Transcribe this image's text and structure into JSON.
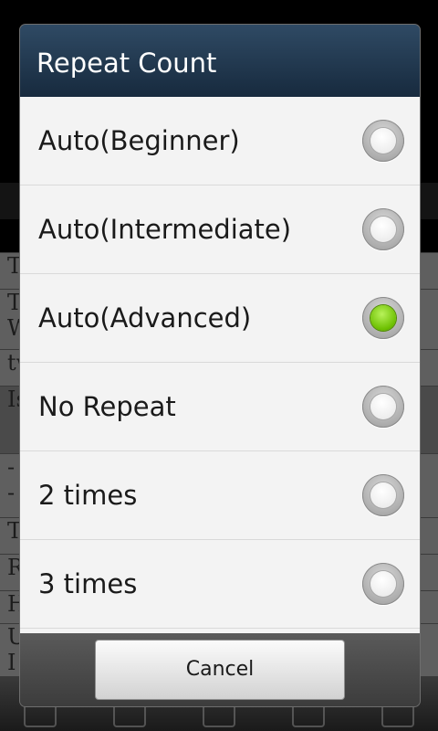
{
  "background": {
    "row_fragments": [
      "T",
      "T",
      "W",
      "tw",
      "Is",
      "-",
      "-",
      "T",
      "R",
      "H",
      "U",
      "I"
    ]
  },
  "dialog": {
    "title": "Repeat Count",
    "options": [
      {
        "label": "Auto(Beginner)",
        "checked": false
      },
      {
        "label": "Auto(Intermediate)",
        "checked": false
      },
      {
        "label": "Auto(Advanced)",
        "checked": true
      },
      {
        "label": "No Repeat",
        "checked": false
      },
      {
        "label": "2 times",
        "checked": false
      },
      {
        "label": "3 times",
        "checked": false
      }
    ],
    "cancel_label": "Cancel"
  },
  "colors": {
    "title_bar": "#1f364d",
    "radio_checked": "#6cbf00",
    "list_background": "#f3f3f3"
  }
}
